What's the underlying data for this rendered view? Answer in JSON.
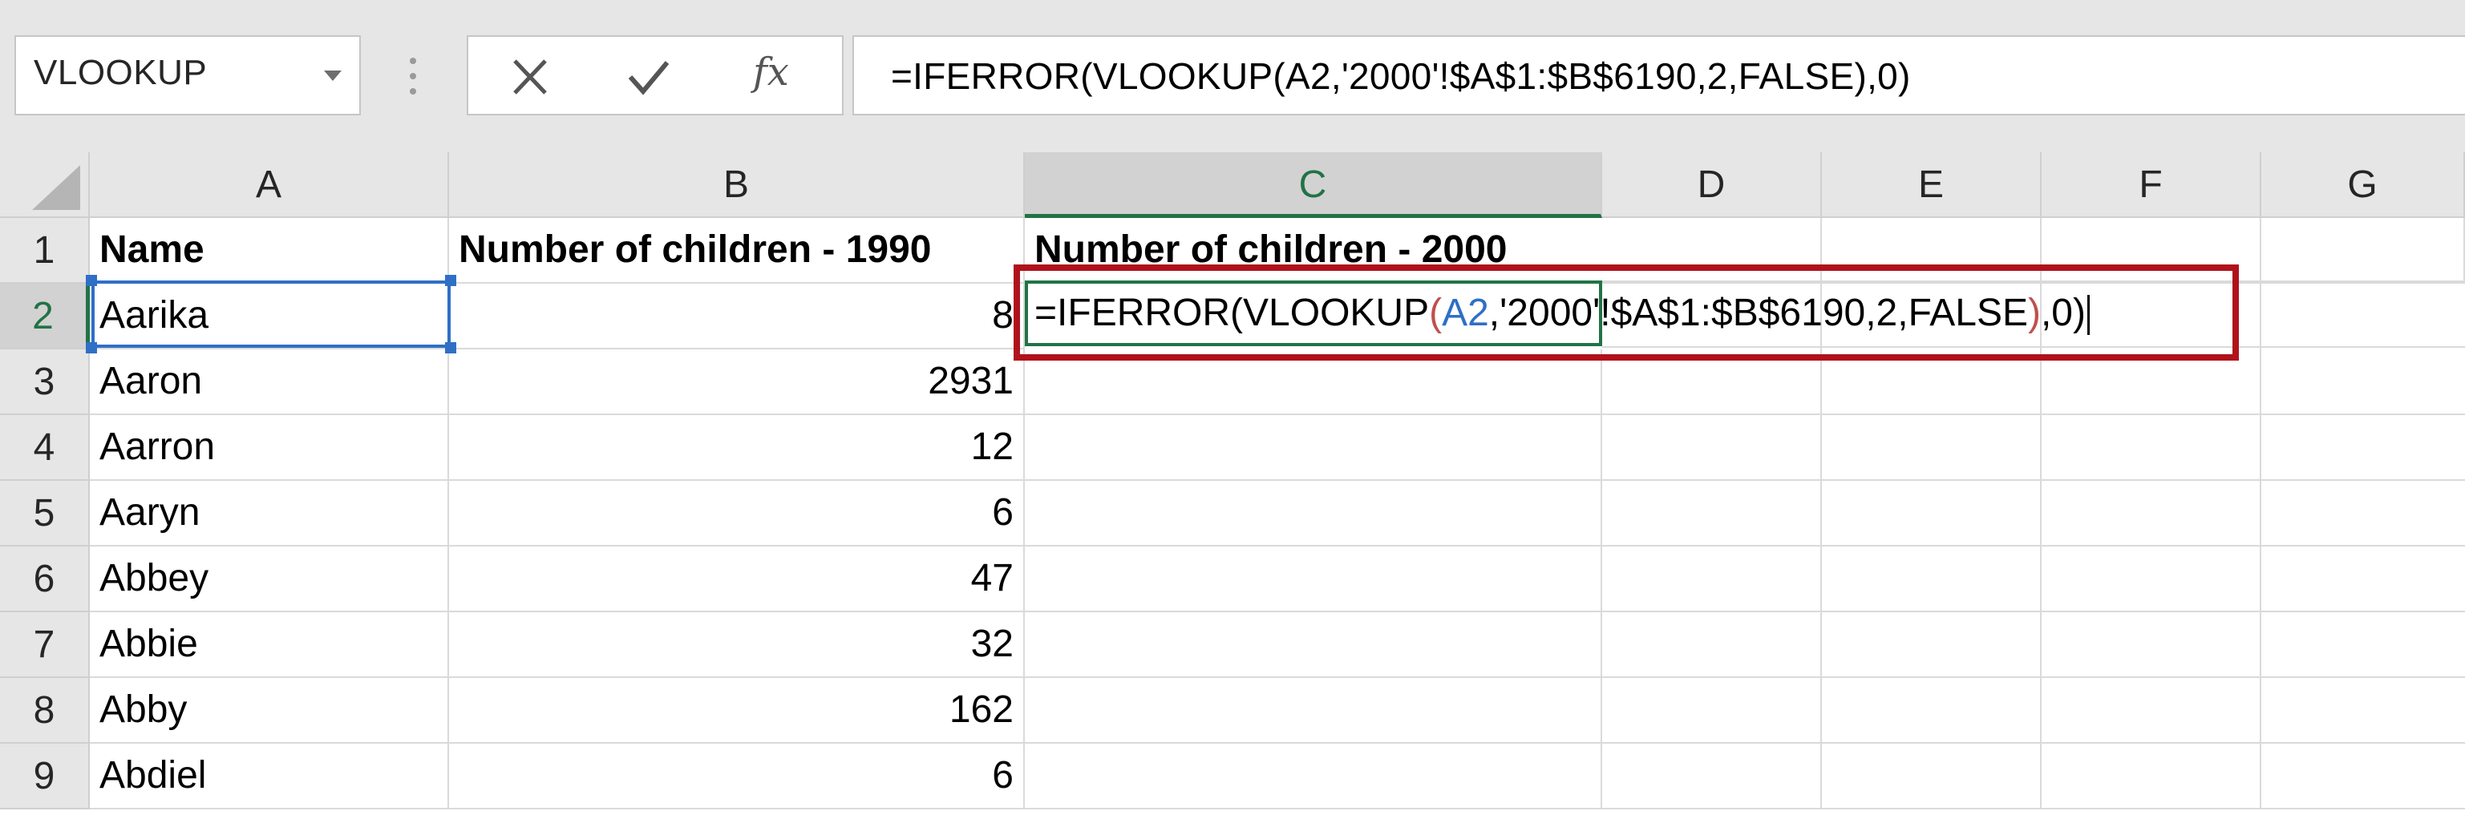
{
  "formula_bar": {
    "name_box": "VLOOKUP",
    "cancel_icon": "close-icon",
    "enter_icon": "checkmark-icon",
    "fx_label": "fx",
    "formula": "=IFERROR(VLOOKUP(A2,'2000'!$A$1:$B$6190,2,FALSE),0)"
  },
  "columns": [
    "A",
    "B",
    "C",
    "D",
    "E",
    "F",
    "G"
  ],
  "rows": [
    "1",
    "2",
    "3",
    "4",
    "5",
    "6",
    "7",
    "8",
    "9"
  ],
  "header_row": {
    "a": "Name",
    "b": "Number of children - 1990",
    "c": "Number of children - 2000"
  },
  "data": [
    {
      "name": "Aarika",
      "count": "8"
    },
    {
      "name": "Aaron",
      "count": "2931"
    },
    {
      "name": "Aarron",
      "count": "12"
    },
    {
      "name": "Aaryn",
      "count": "6"
    },
    {
      "name": "Abbey",
      "count": "47"
    },
    {
      "name": "Abbie",
      "count": "32"
    },
    {
      "name": "Abby",
      "count": "162"
    },
    {
      "name": "Abdiel",
      "count": "6"
    }
  ],
  "edit": {
    "part1": "=IFERROR(VLOOKUP",
    "paren_open": "(",
    "ref": "A2",
    "part2": ",'2000'!$A$1:$B$6190,2,FALSE",
    "paren_close": ")",
    "part3": ",0)"
  },
  "colors": {
    "accent_green": "#217346",
    "ref_blue": "#2f6fc6",
    "paren_red": "#c0504d",
    "callout_red": "#b0121b"
  }
}
